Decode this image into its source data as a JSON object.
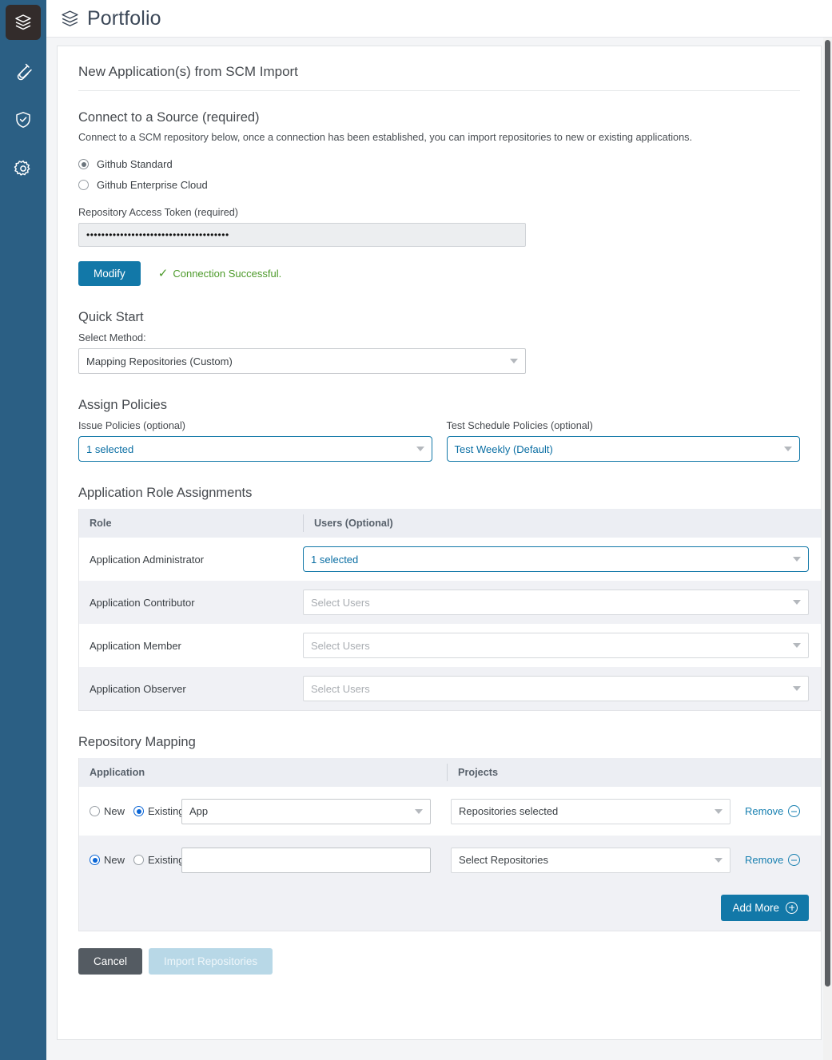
{
  "sidebar": {
    "items": [
      {
        "name": "portfolio",
        "icon": "layers-icon",
        "active": true
      },
      {
        "name": "testing",
        "icon": "test-tube-icon",
        "active": false
      },
      {
        "name": "security",
        "icon": "shield-check-icon",
        "active": false
      },
      {
        "name": "settings",
        "icon": "gear-icon",
        "active": false
      }
    ]
  },
  "topbar": {
    "icon": "layers-icon",
    "title": "Portfolio"
  },
  "card": {
    "title": "New Application(s) from SCM Import"
  },
  "connect": {
    "heading": "Connect to a Source (required)",
    "description": "Connect to a SCM repository below, once a connection has been established, you can import repositories to new or existing applications.",
    "options": [
      {
        "label": "Github Standard",
        "selected": true
      },
      {
        "label": "Github Enterprise Cloud",
        "selected": false
      }
    ],
    "token_label": "Repository Access Token (required)",
    "token_value": "••••••••••••••••••••••••••••••••••••••",
    "modify_label": "Modify",
    "status_text": "Connection Successful.",
    "status_color": "#4c9a2a",
    "check_glyph": "✓"
  },
  "quick_start": {
    "heading": "Quick Start",
    "method_label": "Select Method:",
    "method_value": "Mapping Repositories (Custom)"
  },
  "assign_policies": {
    "heading": "Assign Policies",
    "issue_label": "Issue Policies (optional)",
    "issue_value": "1 selected",
    "test_label": "Test Schedule Policies (optional)",
    "test_value": "Test Weekly (Default)"
  },
  "roles": {
    "heading": "Application Role Assignments",
    "columns": [
      "Role",
      "Users (Optional)"
    ],
    "rows": [
      {
        "role": "Application Administrator",
        "users": "1 selected",
        "selected": true
      },
      {
        "role": "Application Contributor",
        "users": "Select Users",
        "selected": false
      },
      {
        "role": "Application Member",
        "users": "Select Users",
        "selected": false
      },
      {
        "role": "Application Observer",
        "users": "Select Users",
        "selected": false
      }
    ]
  },
  "repo_mapping": {
    "heading": "Repository Mapping",
    "columns": [
      "Application",
      "Projects"
    ],
    "radio_new_label": "New",
    "radio_existing_label": "Existing",
    "remove_label": "Remove",
    "add_more_label": "Add More",
    "rows": [
      {
        "mode": "Existing",
        "app_value": "App",
        "app_is_select": true,
        "projects_value": "Repositories selected",
        "projects_placeholder": false
      },
      {
        "mode": "New",
        "app_value": "",
        "app_is_select": false,
        "projects_value": "Select Repositories",
        "projects_placeholder": false
      }
    ]
  },
  "footer": {
    "cancel_label": "Cancel",
    "import_label": "Import Repositories",
    "import_disabled": true
  },
  "colors": {
    "sidebar": "#2b5f84",
    "sidebar_active": "#332c2b",
    "primary": "#1278a8",
    "link": "#167fb0",
    "success": "#4c9a2a",
    "radio_blue": "#0b66d6",
    "cancel": "#545b62",
    "import_disabled": "#b8d8e7"
  }
}
